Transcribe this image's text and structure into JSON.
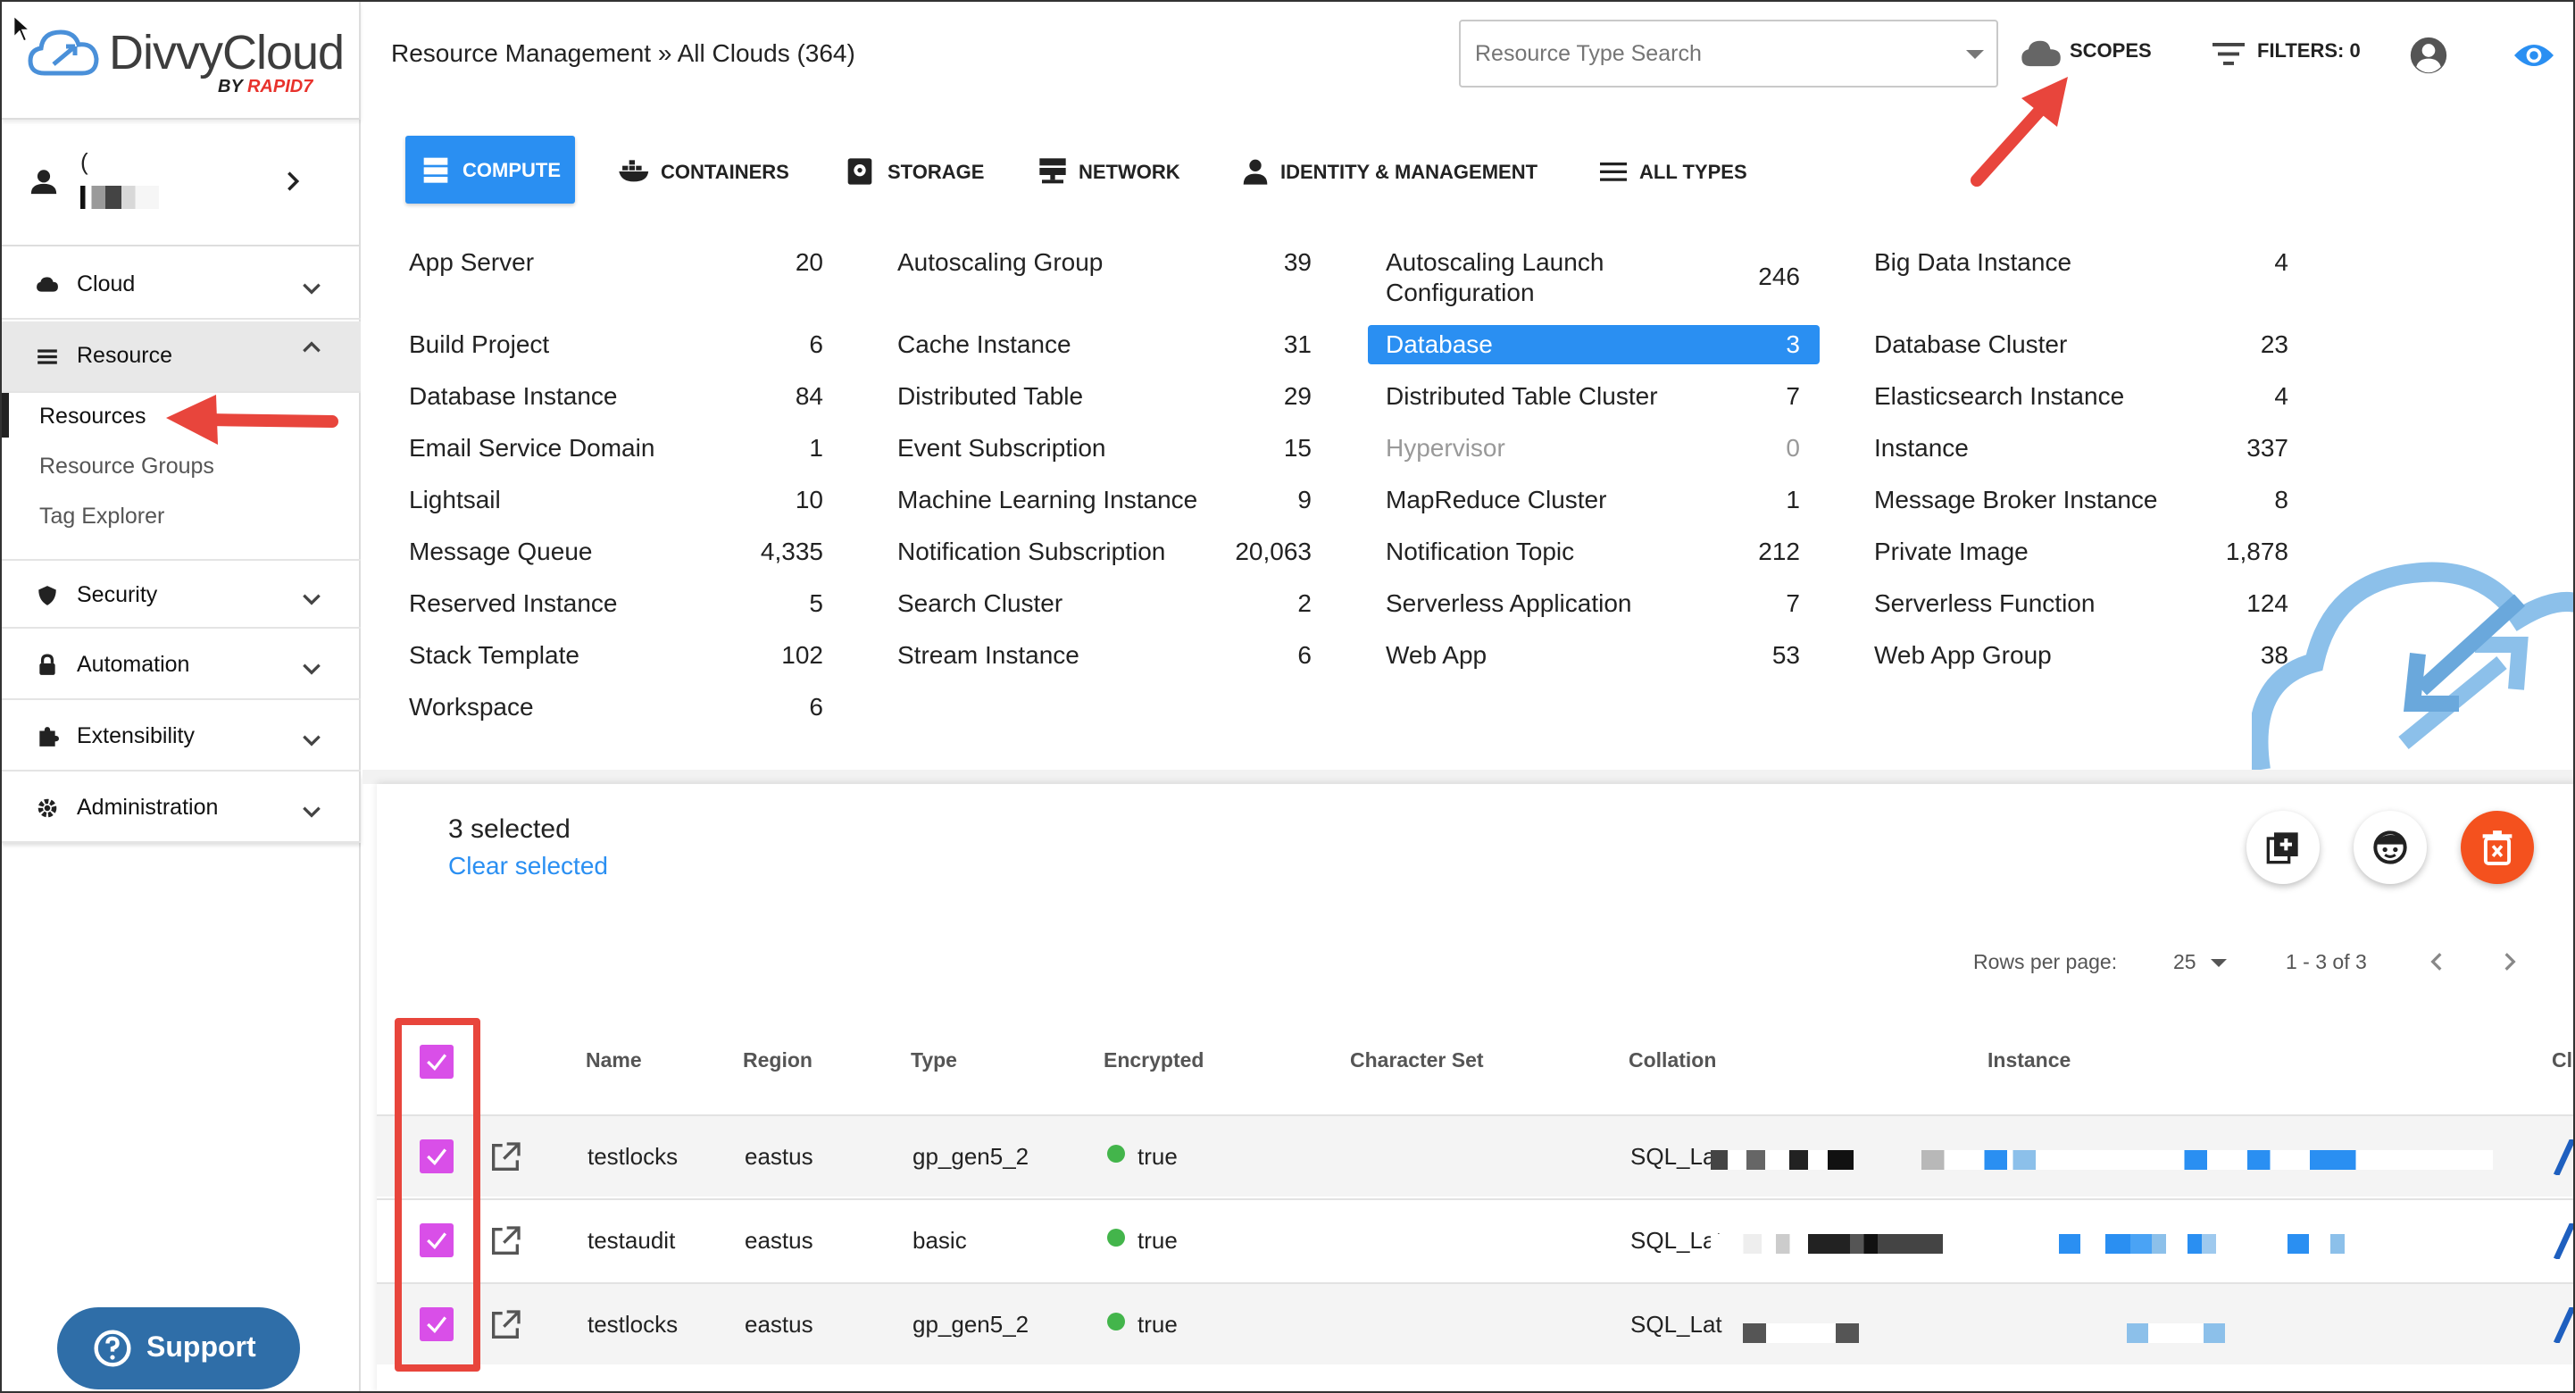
{
  "sidebar": {
    "brand": "DivvyCloud",
    "by_text": "BY",
    "by_brand": "RAPID7",
    "user_name": "(",
    "nav": [
      {
        "label": "Cloud"
      },
      {
        "label": "Resource"
      },
      {
        "label": "Security"
      },
      {
        "label": "Automation"
      },
      {
        "label": "Extensibility"
      },
      {
        "label": "Administration"
      }
    ],
    "sub_items": [
      {
        "label": "Resources"
      },
      {
        "label": "Resource Groups"
      },
      {
        "label": "Tag Explorer"
      }
    ],
    "support_label": "Support"
  },
  "header": {
    "breadcrumb": "Resource Management » All Clouds (364)",
    "search_placeholder": "Resource Type Search",
    "scopes_label": "SCOPES",
    "filters_label": "FILTERS: 0"
  },
  "type_tabs": [
    {
      "label": "COMPUTE"
    },
    {
      "label": "CONTAINERS"
    },
    {
      "label": "STORAGE"
    },
    {
      "label": "NETWORK"
    },
    {
      "label": "IDENTITY & MANAGEMENT"
    },
    {
      "label": "ALL TYPES"
    }
  ],
  "resources": {
    "col1": [
      {
        "name": "App Server",
        "count": "20"
      },
      {
        "name": "Build Project",
        "count": "6"
      },
      {
        "name": "Database Instance",
        "count": "84"
      },
      {
        "name": "Email Service Domain",
        "count": "1"
      },
      {
        "name": "Lightsail",
        "count": "10"
      },
      {
        "name": "Message Queue",
        "count": "4,335"
      },
      {
        "name": "Reserved Instance",
        "count": "5"
      },
      {
        "name": "Stack Template",
        "count": "102"
      },
      {
        "name": "Workspace",
        "count": "6"
      }
    ],
    "col2": [
      {
        "name": "Autoscaling Group",
        "count": "39"
      },
      {
        "name": "Cache Instance",
        "count": "31"
      },
      {
        "name": "Distributed Table",
        "count": "29"
      },
      {
        "name": "Event Subscription",
        "count": "15"
      },
      {
        "name": "Machine Learning Instance",
        "count": "9"
      },
      {
        "name": "Notification Subscription",
        "count": "20,063"
      },
      {
        "name": "Search Cluster",
        "count": "2"
      },
      {
        "name": "Stream Instance",
        "count": "6"
      }
    ],
    "col3": [
      {
        "name": "Autoscaling Launch",
        "name2": "Configuration",
        "count": "246"
      },
      {
        "name": "Database",
        "count": "3"
      },
      {
        "name": "Distributed Table Cluster",
        "count": "7"
      },
      {
        "name": "Hypervisor",
        "count": "0"
      },
      {
        "name": "MapReduce Cluster",
        "count": "1"
      },
      {
        "name": "Notification Topic",
        "count": "212"
      },
      {
        "name": "Serverless Application",
        "count": "7"
      },
      {
        "name": "Web App",
        "count": "53"
      }
    ],
    "col4": [
      {
        "name": "Big Data Instance",
        "count": "4"
      },
      {
        "name": "Database Cluster",
        "count": "23"
      },
      {
        "name": "Elasticsearch Instance",
        "count": "4"
      },
      {
        "name": "Instance",
        "count": "337"
      },
      {
        "name": "Message Broker Instance",
        "count": "8"
      },
      {
        "name": "Private Image",
        "count": "1,878"
      },
      {
        "name": "Serverless Function",
        "count": "124"
      },
      {
        "name": "Web App Group",
        "count": "38"
      }
    ]
  },
  "selection": {
    "selected_text": "3 selected",
    "clear_label": "Clear selected"
  },
  "pagination": {
    "rows_per_page_label": "Rows per page:",
    "rows_per_page": "25",
    "range": "1 - 3 of 3"
  },
  "table": {
    "headers": [
      "Name",
      "Region",
      "Type",
      "Encrypted",
      "Character Set",
      "Collation",
      "Instance",
      "Cl"
    ],
    "rows": [
      {
        "name": "testlocks",
        "region": "eastus",
        "type": "gp_gen5_2",
        "encrypted": "true",
        "collation": "SQL_La"
      },
      {
        "name": "testaudit",
        "region": "eastus",
        "type": "basic",
        "encrypted": "true",
        "collation": "SQL_Lat"
      },
      {
        "name": "testlocks",
        "region": "eastus",
        "type": "gp_gen5_2",
        "encrypted": "true",
        "collation": "SQL_Lat"
      }
    ]
  },
  "colors": {
    "accent": "#2a8ff2",
    "checkbox": "#d94fe8",
    "delete": "#f4511e",
    "annotation": "#e8453c",
    "support": "#2f6ea8"
  }
}
